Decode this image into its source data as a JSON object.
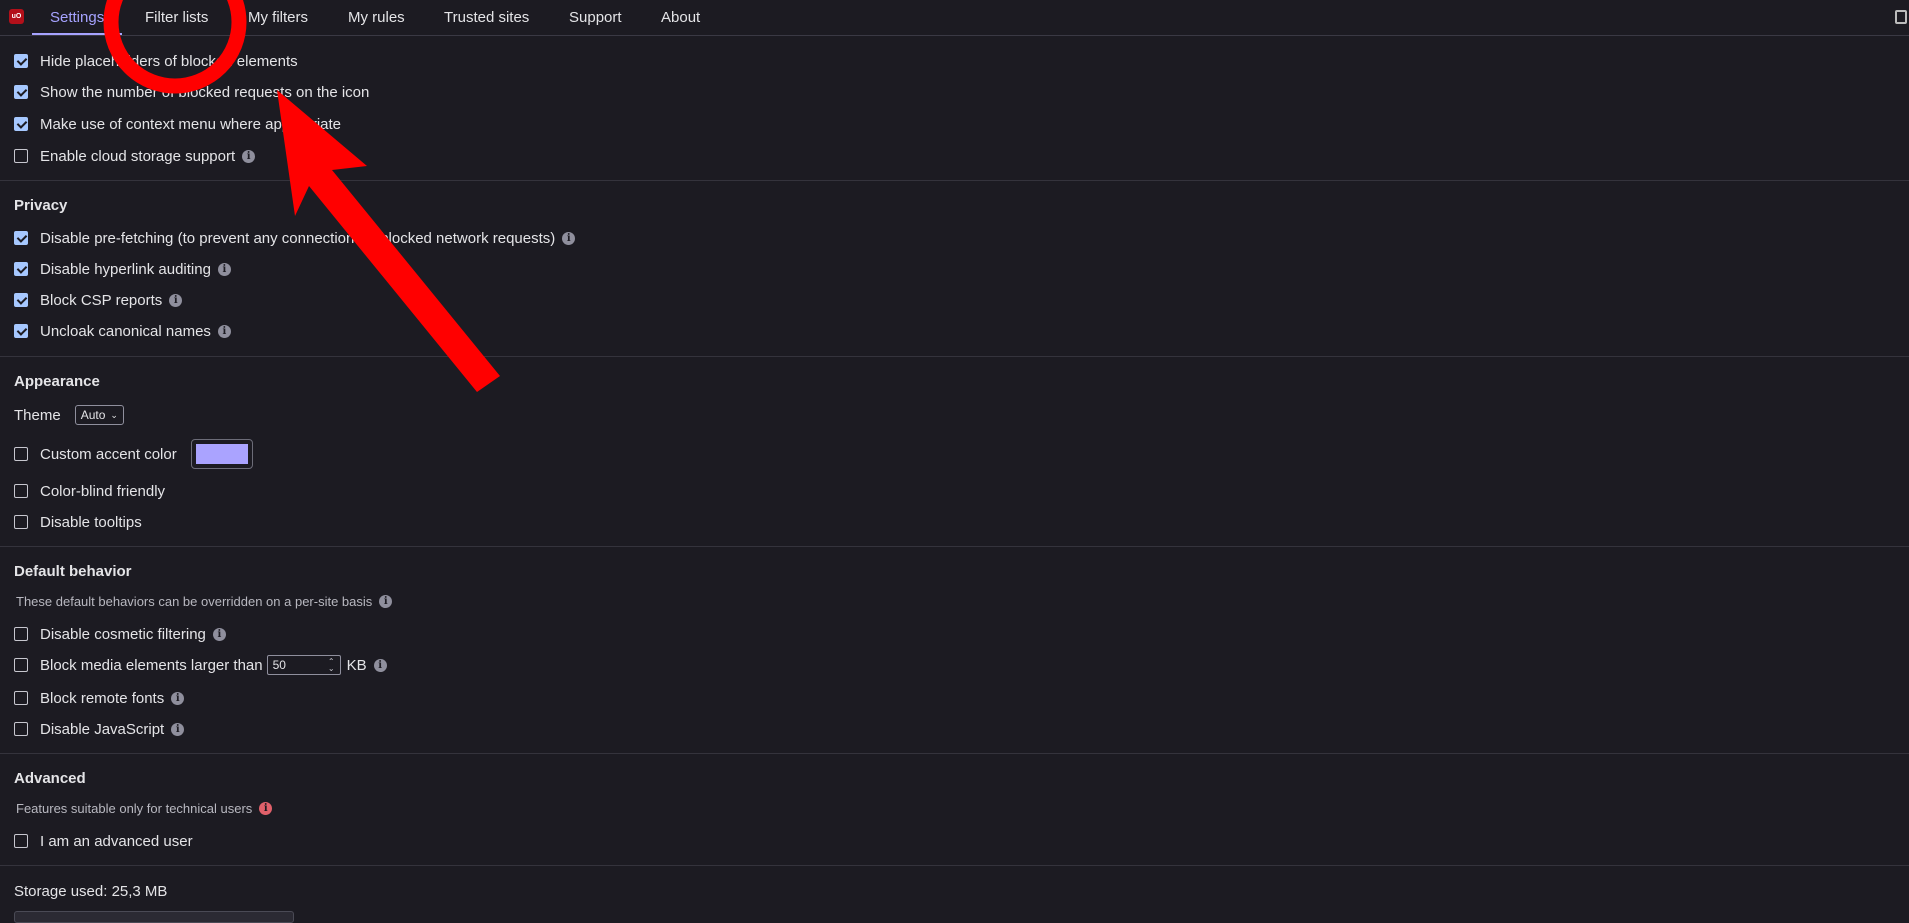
{
  "tabs": [
    {
      "label": "Settings",
      "active": true
    },
    {
      "label": "Filter lists"
    },
    {
      "label": "My filters"
    },
    {
      "label": "My rules"
    },
    {
      "label": "Trusted sites"
    },
    {
      "label": "Support"
    },
    {
      "label": "About"
    }
  ],
  "logo_text": "uO",
  "general": [
    {
      "label": "Hide placeholders of blocked elements",
      "checked": true
    },
    {
      "label": "Show the number of blocked requests on the icon",
      "checked": true
    },
    {
      "label": "Make use of context menu where appropriate",
      "checked": true
    },
    {
      "label": "Enable cloud storage support",
      "checked": false
    }
  ],
  "privacy": {
    "title": "Privacy",
    "items": [
      {
        "label": "Disable pre-fetching (to prevent any connection for blocked network requests)",
        "checked": true
      },
      {
        "label": "Disable hyperlink auditing",
        "checked": true
      },
      {
        "label": "Block CSP reports",
        "checked": true
      },
      {
        "label": "Uncloak canonical names",
        "checked": true
      }
    ]
  },
  "appearance": {
    "title": "Appearance",
    "theme_label": "Theme",
    "theme_value": "Auto",
    "accent_label": "Custom accent color",
    "accent_color": "#aaa3ff",
    "colorblind_label": "Color-blind friendly",
    "tooltips_label": "Disable tooltips"
  },
  "default_behavior": {
    "title": "Default behavior",
    "note": "These default behaviors can be overridden on a per-site basis",
    "cosmetic_label": "Disable cosmetic filtering",
    "media_label": "Block media elements larger than",
    "media_value": "50",
    "media_unit": "KB",
    "fonts_label": "Block remote fonts",
    "js_label": "Disable JavaScript"
  },
  "advanced": {
    "title": "Advanced",
    "note": "Features suitable only for technical users",
    "advanced_user_label": "I am an advanced user"
  },
  "storage": {
    "text": "Storage used: 25,3 MB"
  },
  "colors": {
    "accent": "#a6a3ff",
    "checkbox": "#a6c8ff",
    "annotation": "#ff0000",
    "background": "#1c1b22"
  }
}
